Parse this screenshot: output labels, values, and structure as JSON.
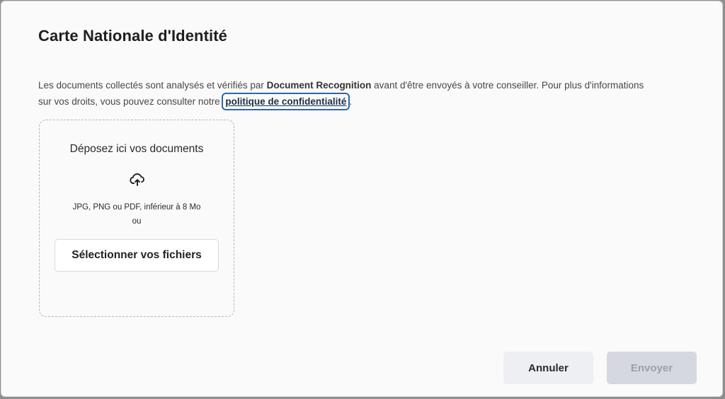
{
  "dialog": {
    "title": "Carte Nationale d'Identité",
    "description": {
      "part1": "Les documents collectés sont analysés et vérifiés par ",
      "brand": "Document Recognition",
      "part2": " avant d'être envoyés à votre conseiller. Pour plus d'informations sur vos droits, vous pouvez consulter notre ",
      "link_label": "politique de confidentialité",
      "part3": "."
    },
    "dropzone": {
      "title": "Déposez ici vos documents",
      "icon": "cloud-upload-icon",
      "formats": "JPG, PNG ou PDF, inférieur à 8 Mo",
      "or": "ou",
      "select_button": "Sélectionner vos fichiers"
    },
    "actions": {
      "cancel": "Annuler",
      "send": "Envoyer"
    }
  }
}
